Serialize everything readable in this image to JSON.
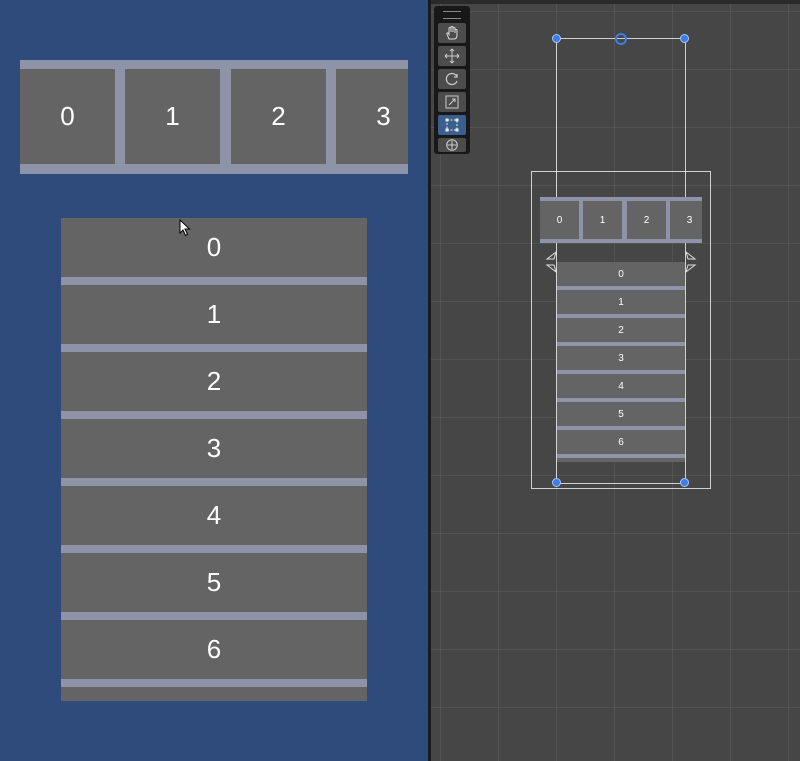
{
  "game_view": {
    "horizontal_list": {
      "items": [
        "0",
        "1",
        "2",
        "3"
      ]
    },
    "vertical_list": {
      "items": [
        "0",
        "1",
        "2",
        "3",
        "4",
        "5",
        "6"
      ]
    }
  },
  "scene_view": {
    "toolbar": {
      "tools": [
        {
          "name": "hand-tool",
          "icon": "hand-icon",
          "active": false
        },
        {
          "name": "move-tool",
          "icon": "move-icon",
          "active": false
        },
        {
          "name": "rotate-tool",
          "icon": "rotate-icon",
          "active": false
        },
        {
          "name": "scale-tool",
          "icon": "scale-icon",
          "active": false
        },
        {
          "name": "rect-tool",
          "icon": "rect-icon",
          "active": true
        },
        {
          "name": "transform-tool",
          "icon": "transform-icon",
          "active": false
        }
      ]
    },
    "horizontal_list": {
      "items": [
        "0",
        "1",
        "2",
        "3"
      ]
    },
    "vertical_list": {
      "items": [
        "0",
        "1",
        "2",
        "3",
        "4",
        "5",
        "6"
      ]
    }
  },
  "colors": {
    "game_background": "#2f4b7c",
    "list_background": "#8f93a8",
    "cell": "#646464",
    "scene_background": "#464646",
    "handle": "#3f7ce8"
  }
}
